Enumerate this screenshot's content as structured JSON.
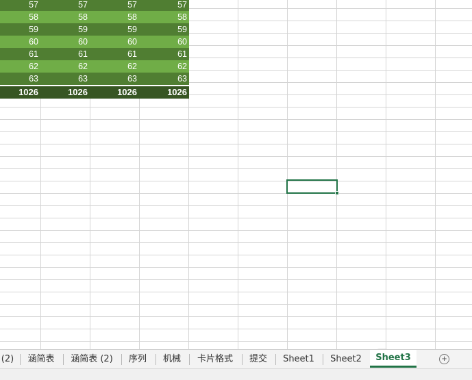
{
  "colors": {
    "row_dark": "#507e32",
    "row_light": "#70ad47",
    "total_row": "#375623",
    "accent": "#217346"
  },
  "data_rows": [
    [
      "57",
      "57",
      "57",
      "57"
    ],
    [
      "58",
      "58",
      "58",
      "58"
    ],
    [
      "59",
      "59",
      "59",
      "59"
    ],
    [
      "60",
      "60",
      "60",
      "60"
    ],
    [
      "61",
      "61",
      "61",
      "61"
    ],
    [
      "62",
      "62",
      "62",
      "62"
    ],
    [
      "63",
      "63",
      "63",
      "63"
    ]
  ],
  "total_row": [
    "1026",
    "1026",
    "1026",
    "1026"
  ],
  "sheet_tabs": [
    {
      "label": "(2)",
      "active": false
    },
    {
      "label": "涵简表",
      "active": false
    },
    {
      "label": "涵简表 (2)",
      "active": false
    },
    {
      "label": "序列",
      "active": false
    },
    {
      "label": "机械",
      "active": false
    },
    {
      "label": "卡片格式",
      "active": false
    },
    {
      "label": "提交",
      "active": false
    },
    {
      "label": "Sheet1",
      "active": false
    },
    {
      "label": "Sheet2",
      "active": false
    },
    {
      "label": "Sheet3",
      "active": true
    }
  ],
  "add_sheet_icon": "plus-circle-icon",
  "watermark_icon": "watermark-logo"
}
